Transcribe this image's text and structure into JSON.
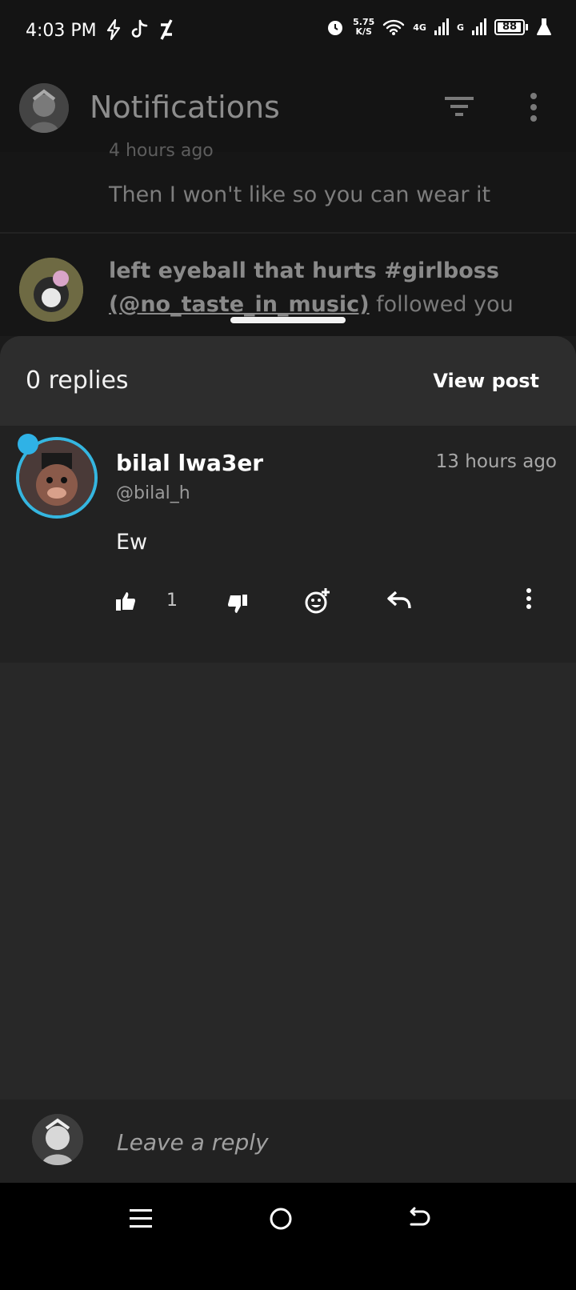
{
  "status_bar": {
    "time": "4:03 PM",
    "speed_value": "5.75",
    "speed_unit": "K/S",
    "net1": "4G",
    "net2": "G",
    "battery": "88"
  },
  "header": {
    "title": "Notifications"
  },
  "notifications": {
    "first_time": "4 hours ago",
    "first_text": "Then I won't like so you can wear it",
    "second_name": "left eyeball that hurts #girlboss",
    "second_mention": "(@no_taste_in_music)",
    "second_action": "followed",
    "second_tail": "you"
  },
  "sheet": {
    "replies": "0 replies",
    "view_post": "View post"
  },
  "comment": {
    "name": "bilal lwa3er",
    "handle": "@bilal_h",
    "time": "13 hours ago",
    "body": "Ew",
    "likes": "1"
  },
  "reply": {
    "placeholder": "Leave a reply"
  },
  "icons": {
    "like": "thumbs-up-icon",
    "dislike": "thumbs-down-icon",
    "react": "add-reaction-icon",
    "reply": "reply-icon",
    "more": "more-vertical-icon"
  }
}
